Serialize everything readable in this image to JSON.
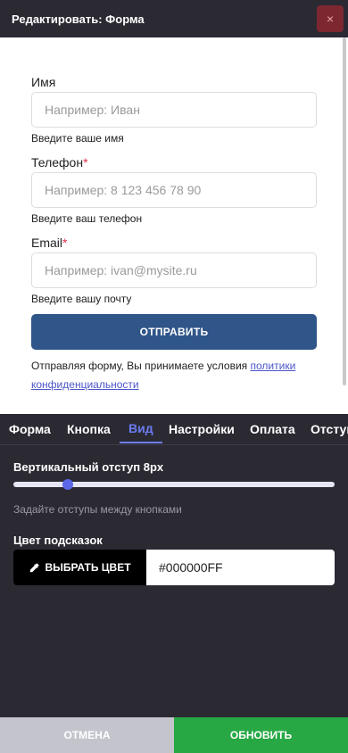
{
  "header": {
    "title": "Редактировать: Форма",
    "close_icon": "×"
  },
  "form": {
    "fields": [
      {
        "label": "Имя",
        "required": "",
        "placeholder": "Например: Иван",
        "hint": "Введите ваше имя"
      },
      {
        "label": "Телефон",
        "required": "*",
        "placeholder": "Например: 8 123 456 78 90",
        "hint": "Введите ваш телефон"
      },
      {
        "label": "Email",
        "required": "*",
        "placeholder": "Например: ivan@mysite.ru",
        "hint": "Введите вашу почту"
      }
    ],
    "submit_label": "ОТПРАВИТЬ",
    "consent_text": "Отправляя форму, Вы принимаете условия ",
    "consent_link": "политики конфиденциальности"
  },
  "tabs": [
    {
      "label": "Форма",
      "active": false
    },
    {
      "label": "Кнопка",
      "active": false
    },
    {
      "label": "Вид",
      "active": true
    },
    {
      "label": "Настройки",
      "active": false
    },
    {
      "label": "Оплата",
      "active": false
    },
    {
      "label": "Отступы",
      "active": false
    }
  ],
  "panel": {
    "spacing_label": "Вертикальный отступ 8px",
    "spacing_value_fraction": 0.17,
    "spacing_hint": "Задайте отступы между кнопками",
    "hint_color_label": "Цвет подсказок",
    "pick_color_label": "ВЫБРАТЬ ЦВЕТ",
    "pick_color_icon": "pipette-icon",
    "color_value": "#000000FF"
  },
  "footer": {
    "cancel_label": "ОТМЕНА",
    "update_label": "ОБНОВИТЬ"
  },
  "colors": {
    "accent": "#6b7bf2",
    "submit": "#2f5589",
    "update": "#27a844",
    "cancel": "#c3c4cc",
    "close": "#7d2731",
    "required": "#e0334a"
  }
}
